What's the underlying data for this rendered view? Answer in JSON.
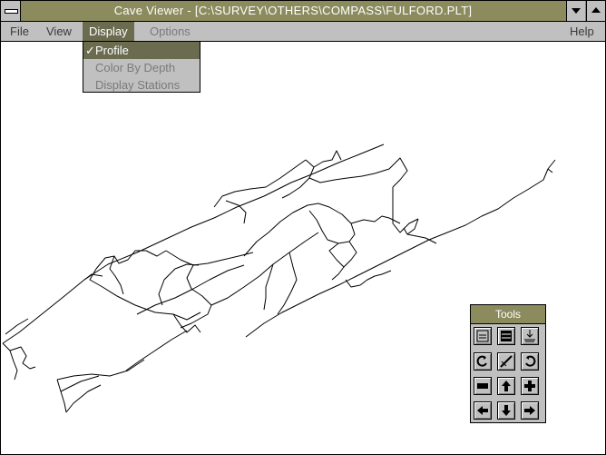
{
  "window": {
    "title": "Cave Viewer - [C:\\SURVEY\\OTHERS\\COMPASS\\FULFORD.PLT]"
  },
  "menu": {
    "file": "File",
    "view": "View",
    "display": "Display",
    "options": "Options",
    "help": "Help"
  },
  "display_menu": {
    "items": [
      {
        "label": "Profile",
        "checked": true,
        "check_glyph": "✓"
      },
      {
        "label": "Color By Depth",
        "checked": false
      },
      {
        "label": "Display Stations",
        "checked": false
      }
    ]
  },
  "tools": {
    "title": "Tools",
    "buttons": [
      "zoom-in-icon",
      "zoom-full-icon",
      "zoom-out-icon",
      "rotate-left-icon",
      "tilt-icon",
      "rotate-right-icon",
      "stop-icon",
      "pan-up-icon",
      "reset-icon",
      "pan-left-icon",
      "pan-down-icon",
      "pan-right-icon"
    ]
  },
  "colors": {
    "titlebar": "#8b8b5e",
    "menu_highlight": "#6b6b50",
    "chrome": "#c0c0c0",
    "plot_line": "#000000"
  }
}
